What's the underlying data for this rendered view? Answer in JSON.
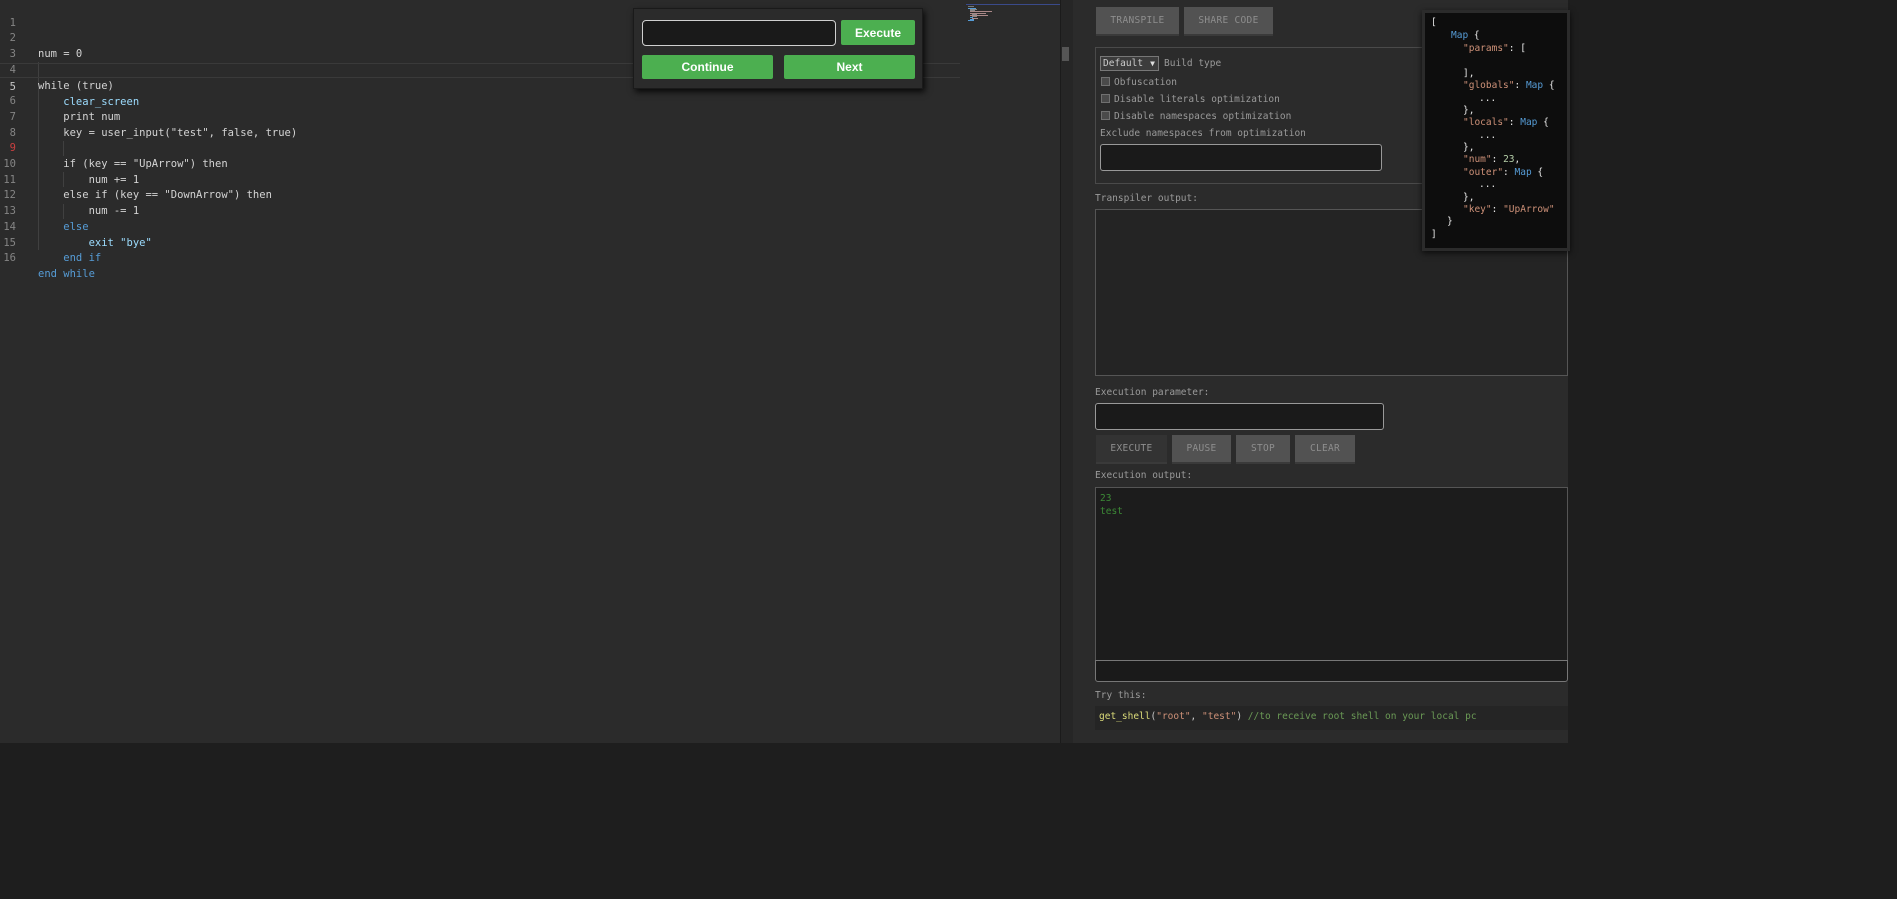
{
  "editor": {
    "lines": [
      {
        "n": "1",
        "text": ""
      },
      {
        "n": "2",
        "text": "num = 0"
      },
      {
        "n": "3",
        "text": ""
      },
      {
        "n": "4",
        "text": "while (true)"
      },
      {
        "n": "5",
        "text": "    clear_screen"
      },
      {
        "n": "6",
        "text": "    print num"
      },
      {
        "n": "7",
        "text": "    key = user_input(\"test\", false, true)"
      },
      {
        "n": "8",
        "text": ""
      },
      {
        "n": "9",
        "text": "    if (key == \"UpArrow\") then"
      },
      {
        "n": "10",
        "text": "        num += 1"
      },
      {
        "n": "11",
        "text": "    else if (key == \"DownArrow\") then"
      },
      {
        "n": "12",
        "text": "        num -= 1"
      },
      {
        "n": "13",
        "text": "    else"
      },
      {
        "n": "14",
        "text": "        exit \"bye\""
      },
      {
        "n": "15",
        "text": "    end if"
      },
      {
        "n": "16",
        "text": "end while"
      }
    ],
    "active_line": "5",
    "breakpoint_line": "9"
  },
  "debug_popup": {
    "input_value": "",
    "execute_label": "Execute",
    "continue_label": "Continue",
    "next_label": "Next"
  },
  "toolbar": {
    "transpile_label": "TRANSPILE",
    "share_label": "SHARE CODE"
  },
  "build": {
    "selected": "Default",
    "build_type_label": "Build type",
    "obfuscation_label": "Obfuscation",
    "literals_label": "Disable literals optimization",
    "namespaces_label": "Disable namespaces optimization",
    "exclude_label": "Exclude namespaces from optimization",
    "exclude_value": ""
  },
  "transpiler": {
    "label": "Transpiler output:",
    "output": ""
  },
  "execution": {
    "param_label": "Execution parameter:",
    "param_value": "",
    "execute_label": "EXECUTE",
    "pause_label": "PAUSE",
    "stop_label": "STOP",
    "clear_label": "CLEAR",
    "output_label": "Execution output:",
    "output_lines": [
      "23",
      "test"
    ],
    "input_value": ""
  },
  "try_this": {
    "label": "Try this:",
    "fn": "get_shell",
    "open": "(",
    "arg1": "\"root\"",
    "sep": ", ",
    "arg2": "\"test\"",
    "close": ")",
    "comment": " //to receive root shell on your local pc"
  },
  "variables": {
    "l1": "[",
    "l2_type": "Map",
    "l2_brace": " {",
    "params_key": "\"params\"",
    "params_val": ": [",
    "params_close": "],",
    "globals_key": "\"globals\"",
    "globals_type": "Map",
    "brace_open": " {",
    "ellipsis": "...",
    "brace_close": "},",
    "locals_key": "\"locals\"",
    "locals_type": "Map",
    "num_key": "\"num\"",
    "num_val": "23",
    "outer_key": "\"outer\"",
    "outer_type": "Map",
    "key_key": "\"key\"",
    "key_val": "\"UpArrow\"",
    "map_close": "}",
    "list_close": "]"
  },
  "colors": {
    "accent_green": "#4caf50",
    "keyword_blue": "#569cd6",
    "string_orange": "#ce9178",
    "breakpoint_red": "#c94040",
    "output_green": "#3c8a36"
  }
}
